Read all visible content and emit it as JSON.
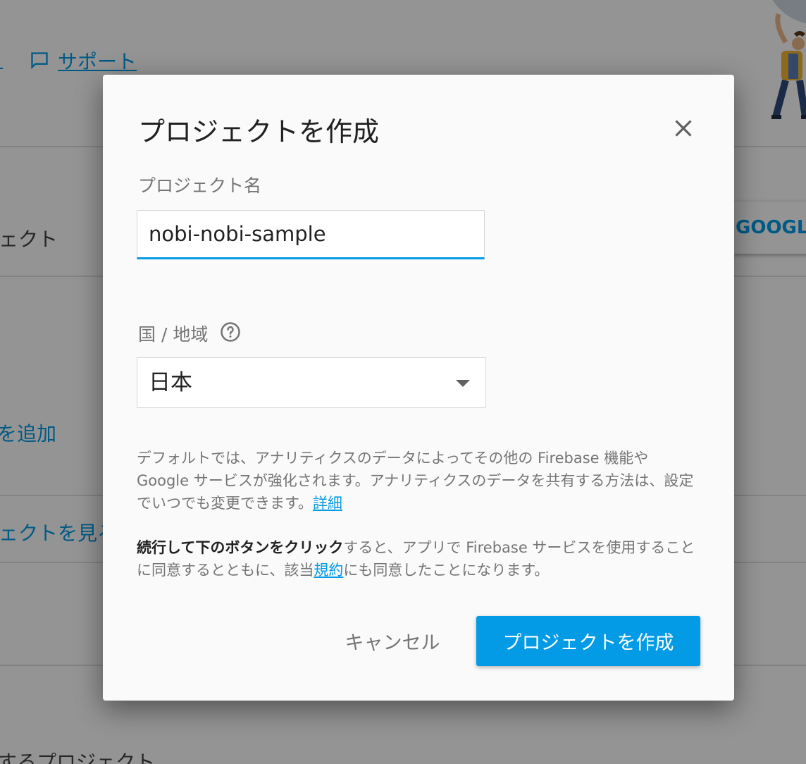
{
  "background": {
    "support_link": "サポート",
    "projects_heading": "ェクト",
    "add_project_link": "を追加",
    "view_projects_link": "ェクトを見る",
    "bottom_heading": "するプロジェクト",
    "google_button": "GOOGLE"
  },
  "dialog": {
    "title": "プロジェクトを作成",
    "project_name_label": "プロジェクト名",
    "project_name_value": "nobi-nobi-sample",
    "country_label": "国 / 地域",
    "country_value": "日本",
    "analytics_text": "デフォルトでは、アナリティクスのデータによってその他の Firebase 機能や Google サービスが強化されます。アナリティクスのデータを共有する方法は、設定でいつでも変更できます。",
    "analytics_link": "詳細",
    "terms_bold": "続行して下のボタンをクリック",
    "terms_text_1": "すると、アプリで Firebase サービスを使用することに同意するとともに、該当",
    "terms_link": "規約",
    "terms_text_2": "にも同意したことになります。",
    "cancel_label": "キャンセル",
    "create_label": "プロジェクトを作成"
  },
  "icons": {
    "close": "close-icon",
    "help": "help-circle-icon",
    "dropdown": "caret-down-icon",
    "support": "chat-bubble-icon"
  },
  "colors": {
    "accent": "#039be5",
    "dialog_bg": "#fafafa",
    "text_primary": "#212121",
    "text_secondary": "#757575"
  }
}
